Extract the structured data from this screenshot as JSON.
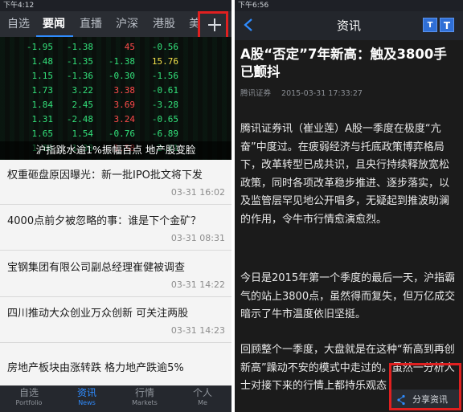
{
  "left": {
    "status_time": "下午4:12",
    "tabs": [
      "自选",
      "要闻",
      "直播",
      "沪深",
      "港股",
      "美"
    ],
    "active_tab": "要闻",
    "hero": {
      "caption": "沪指跳水逾1%振幅百点 地产股变脸",
      "ticker_columns": [
        [
          "-1.95",
          "1.48",
          "1.15",
          "1.73",
          "1.84",
          "1.31",
          "1.65",
          "1.86"
        ],
        [
          "-1.38",
          "-1.35",
          "-1.36",
          "3.22",
          "2.45",
          "-2.48",
          "1.54",
          "1.38"
        ],
        [
          "45",
          "-1.38",
          "-0.30",
          "3.38",
          "3.69",
          "3.24",
          "-0.76",
          "1.58"
        ],
        [
          "-0.56",
          "15.76",
          "-1.56",
          "-0.61",
          "-3.28",
          "-0.65",
          "-6.89",
          "2.81"
        ]
      ]
    },
    "news": [
      {
        "title": "权重砸盘原因曝光：新一批IPO批文将下发",
        "time": "03-31 16:02"
      },
      {
        "title": "4000点前夕被忽略的事：谁是下个金矿？",
        "time": "03-31 08:31"
      },
      {
        "title": "宝钢集团有限公司副总经理崔健被调查",
        "time": "03-31 14:22"
      },
      {
        "title": "四川推动大众创业万众创新 可关注两股",
        "time": "03-31 14:23"
      },
      {
        "title": "房地产板块由涨转跌 格力地产跌逾5%",
        "time": ""
      }
    ],
    "bottom_nav": [
      {
        "zh": "自选",
        "en": "Portfolio"
      },
      {
        "zh": "资讯",
        "en": "News"
      },
      {
        "zh": "行情",
        "en": "Markets"
      },
      {
        "zh": "个人",
        "en": "Me"
      }
    ],
    "active_nav": "资讯"
  },
  "right": {
    "status_time": "下午6:56",
    "header_title": "资讯",
    "font_buttons": [
      "T",
      "T"
    ],
    "article": {
      "title": "A股“否定”7年新高：触及3800手已颤抖",
      "source": "腾讯证券",
      "datetime": "2015-03-31 17:33:27",
      "paragraphs": [
        "腾讯证券讯（崔业莲）A股一季度在极度“亢奋”中度过。在疲弱经济与托底政策博弈格局下，改革转型已成共识，且央行持续释放宽松政策，同时各项改革稳步推进、逐步落实，以及监管层罕见地公开唱多，无疑起到推波助澜的作用，令牛市行情愈演愈烈。",
        "今日是2015年第一个季度的最后一天，沪指霸气的站上3800点，虽然得而复失，但万亿成交暗示了牛市温度依旧坚挺。",
        "回顾整个一季度，大盘就是在这种“新高到再创新高”躁动不安的模式中走过的。虽然一分析人士对接下来的行情上都持乐观态"
      ]
    },
    "share_label": "分享资讯"
  },
  "colors": {
    "accent_blue": "#2f8cff",
    "highlight_red": "#e02020",
    "ticker_green": "#33e07a",
    "ticker_red": "#ff4a4a",
    "ticker_yellow": "#f2e04a"
  }
}
